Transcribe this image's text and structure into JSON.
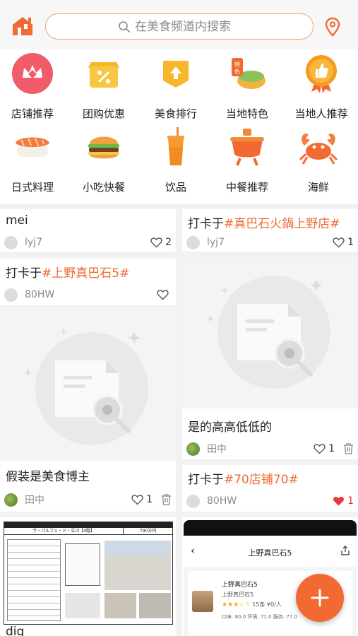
{
  "search": {
    "placeholder": "在美食频道内搜索"
  },
  "categories": [
    {
      "label": "店铺推荐",
      "icon": "crown-icon"
    },
    {
      "label": "团购优惠",
      "icon": "coupon-box-icon"
    },
    {
      "label": "美食排行",
      "icon": "ranking-icon"
    },
    {
      "label": "当地特色",
      "icon": "local-specialty-icon"
    },
    {
      "label": "当地人推荐",
      "icon": "thumbs-up-medal-icon"
    },
    {
      "label": "日式料理",
      "icon": "sushi-icon"
    },
    {
      "label": "小吃快餐",
      "icon": "burger-icon"
    },
    {
      "label": "饮品",
      "icon": "drink-icon"
    },
    {
      "label": "中餐推荐",
      "icon": "hotpot-icon"
    },
    {
      "label": "海鲜",
      "icon": "crab-icon"
    }
  ],
  "feed": {
    "c1": {
      "title": "mei",
      "user": "lyj7",
      "likes": "2"
    },
    "c2": {
      "title_prefix": "打卡于",
      "tag": "#真巴石火鍋上野店#",
      "user": "lyj7",
      "likes": "1"
    },
    "c3": {
      "title_prefix": "打卡于",
      "tag": "#上野真巴石5#",
      "user": "80HW",
      "likes": ""
    },
    "c4": {
      "title": "是的高高低低的",
      "user": "田中",
      "likes": "1"
    },
    "c5": {
      "title": "假装是美食博主",
      "user": "田中",
      "likes": "1"
    },
    "c6": {
      "title_prefix": "打卡于",
      "tag": "#70店铺70#",
      "user": "80HW",
      "likes": "1"
    },
    "c7": {
      "title": "dig"
    },
    "c8": {
      "screen_title": "上野真巴石5",
      "shop_name": "上野真巴石5",
      "shop_sub": "上野真巴石5",
      "rating_text": "15条 ¥0/人",
      "scores": "口味: 80.0  环境: 71.0  服务: 77.0"
    },
    "listing": {
      "price": "790万円",
      "name": "ラ・パルフェ・ド・立川【4階】"
    }
  },
  "colors": {
    "accent": "#f06a32",
    "like_active": "#e8363c"
  }
}
